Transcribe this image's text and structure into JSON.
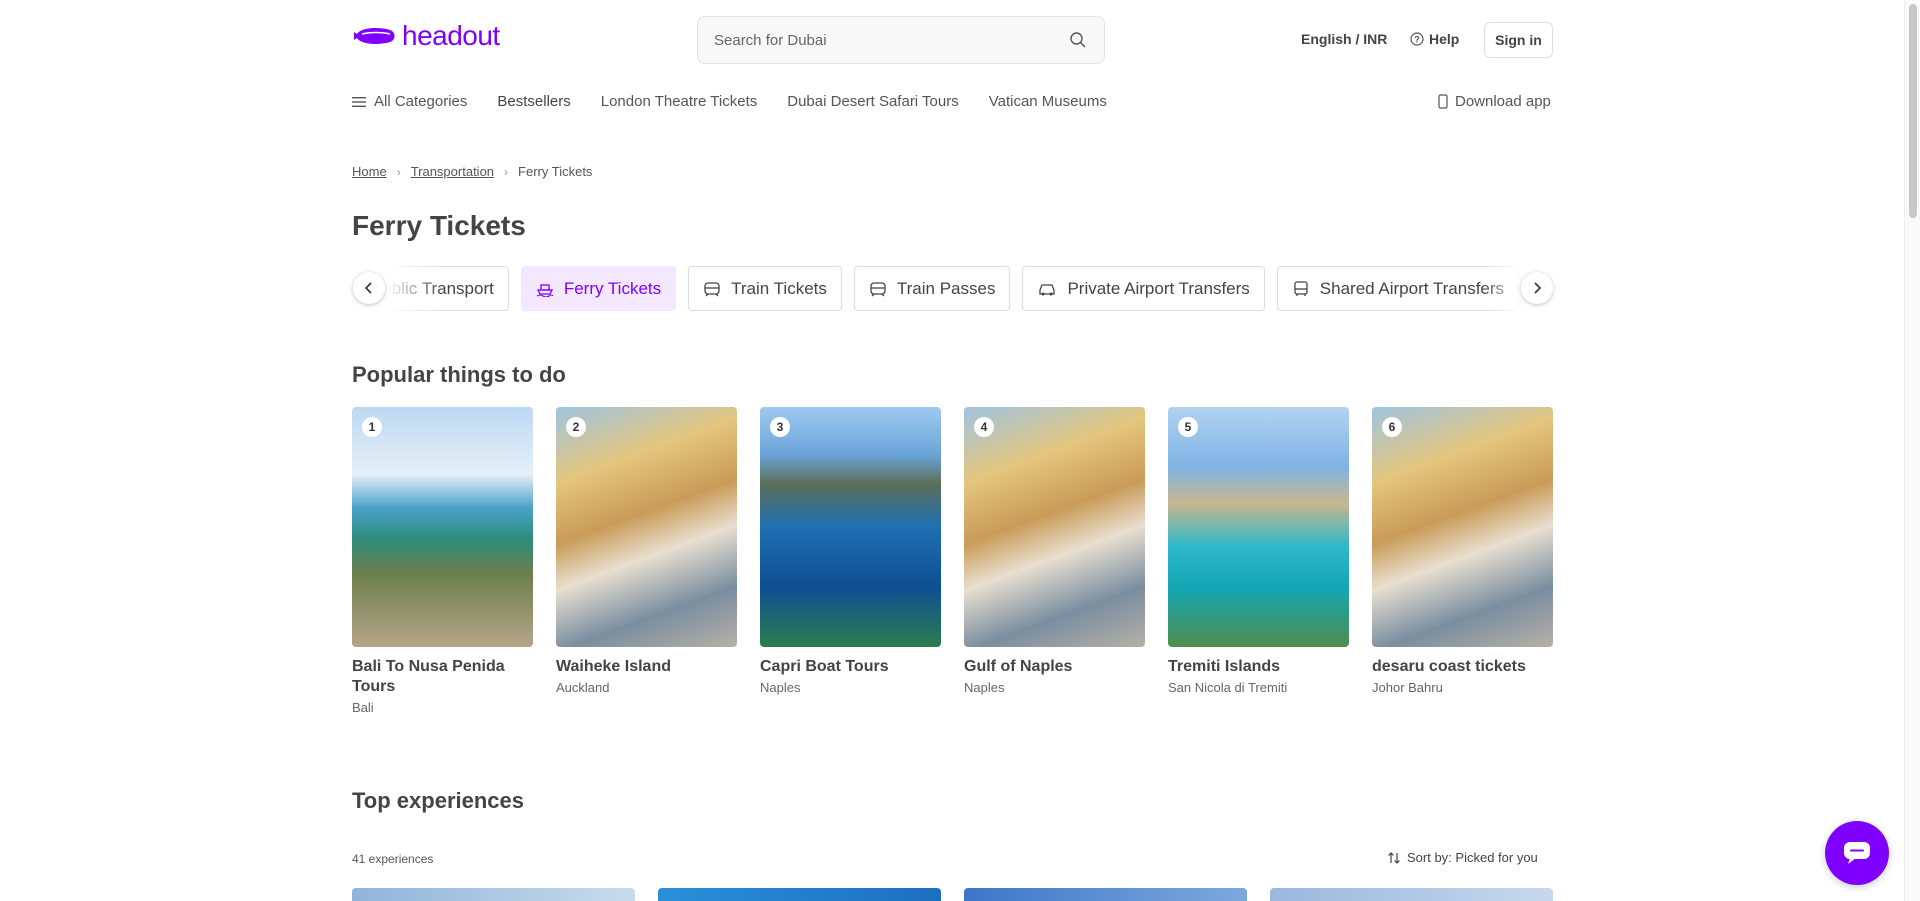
{
  "header": {
    "logo_text": "headout",
    "search_placeholder": "Search for Dubai",
    "language": "English / INR",
    "help": "Help",
    "signin": "Sign in",
    "brand_color": "#8000ff"
  },
  "nav": {
    "all_categories": "All Categories",
    "items": [
      "Bestsellers",
      "London Theatre Tickets",
      "Dubai Desert Safari Tours",
      "Vatican Museums"
    ],
    "download_app": "Download app"
  },
  "breadcrumb": {
    "home": "Home",
    "transportation": "Transportation",
    "current": "Ferry Tickets"
  },
  "page_title": "Ferry Tickets",
  "chips": [
    {
      "label": "Public Transport",
      "icon": "bus-icon"
    },
    {
      "label": "Ferry Tickets",
      "icon": "ferry-icon",
      "active": true
    },
    {
      "label": "Train Tickets",
      "icon": "train-icon"
    },
    {
      "label": "Train Passes",
      "icon": "train-icon"
    },
    {
      "label": "Private Airport Transfers",
      "icon": "car-icon"
    },
    {
      "label": "Shared Airport Transfers",
      "icon": "bus-icon"
    }
  ],
  "popular": {
    "title": "Popular things to do",
    "items": [
      {
        "rank": "1",
        "title": "Bali To Nusa Penida Tours",
        "location": "Bali"
      },
      {
        "rank": "2",
        "title": "Waiheke Island",
        "location": "Auckland"
      },
      {
        "rank": "3",
        "title": "Capri Boat Tours",
        "location": "Naples"
      },
      {
        "rank": "4",
        "title": "Gulf of Naples",
        "location": "Naples"
      },
      {
        "rank": "5",
        "title": "Tremiti Islands",
        "location": "San Nicola di Tremiti"
      },
      {
        "rank": "6",
        "title": "desaru coast tickets",
        "location": "Johor Bahru"
      }
    ]
  },
  "top_experiences": {
    "title": "Top experiences",
    "count": "41 experiences",
    "sort": "Sort by: Picked for you"
  }
}
